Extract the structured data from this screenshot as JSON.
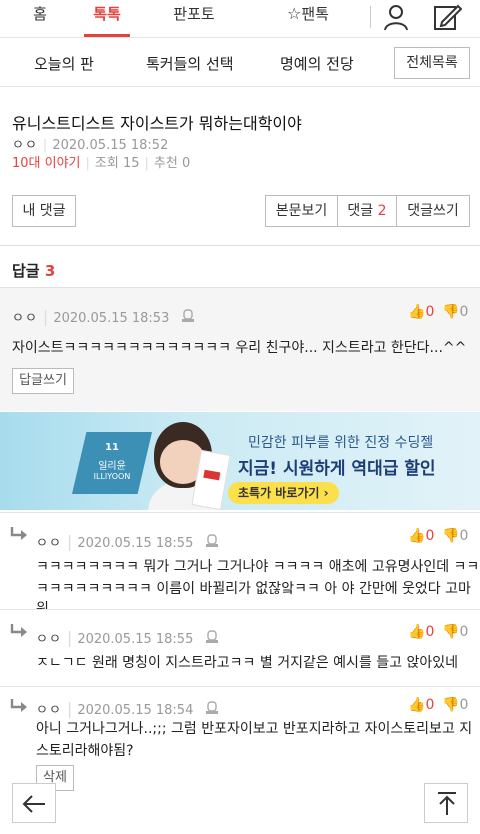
{
  "nav": {
    "tabs": [
      "홈",
      "톡톡",
      "판포토",
      "팬톡"
    ],
    "active_tab": "톡톡",
    "accent_color": "#e8413c"
  },
  "subnav": {
    "items": [
      "오늘의 판",
      "톡커들의 선택",
      "명예의 전당"
    ],
    "list_button": "전체목록"
  },
  "post": {
    "title": "유니스트디스트 자이스트가 뭐하는대학이야",
    "author": "ㅇㅇ",
    "datetime": "2020.05.15 18:52",
    "category": "10대 이야기",
    "views": "조회 15",
    "recommends": "추천 0"
  },
  "actions": {
    "my_comments": "내 댓글",
    "view_post": "본문보기",
    "comments_label": "댓글",
    "comments_count": "2",
    "write_comment": "댓글쓰기"
  },
  "replies_header": {
    "label": "답글",
    "count": "3"
  },
  "best_comment": {
    "author": "ㅇㅇ",
    "datetime": "2020.05.15 18:53",
    "up": "0",
    "down": "0",
    "text": "자이스트ㅋㅋㅋㅋㅋㅋㅋㅋㅋㅋㅋㅋㅋ 우리 친구야... 지스트라고 한단다...^^",
    "reply_button": "답글쓰기"
  },
  "ad": {
    "brand_top": "11",
    "brand_name": "일리윤",
    "brand_en": "ILLIYOON",
    "line1": "민감한 피부를 위한 진정 수딩젤",
    "line2": "지금! 시원하게 역대급 할인",
    "cta": "초특가 바로가기 ›"
  },
  "replies": [
    {
      "author": "ㅇㅇ",
      "datetime": "2020.05.15 18:55",
      "up": "0",
      "down": "0",
      "line1": "ㅋㅋㅋㅋㅋㅋㅋㅋ 뭐가 그거나 그거나야 ㅋㅋㅋㅋ 애초에 고유명사인데 ㅋㅋ",
      "line2": "ㅋㅋㅋㅋㅋㅋㅋㅋㅋ 이름이 바뀔리가 없잖앜ㅋㅋ 아 야 간만에 웃었다 고마워"
    },
    {
      "author": "ㅇㅇ",
      "datetime": "2020.05.15 18:55",
      "up": "0",
      "down": "0",
      "line1": "ㅈㄴㄱㄷ 원래 명칭이 지스트라고ㅋㅋ 별 거지같은 예시를 들고 앉아있네"
    },
    {
      "author": "ㅇㅇ",
      "datetime": "2020.05.15 18:54",
      "up": "0",
      "down": "0",
      "line1": "아니 그거나그거나..;;; 그럼 반포자이보고 반포지라하고 자이스토리보고 지",
      "line2": "스토리라해야됨?",
      "delete_button": "삭제"
    }
  ]
}
